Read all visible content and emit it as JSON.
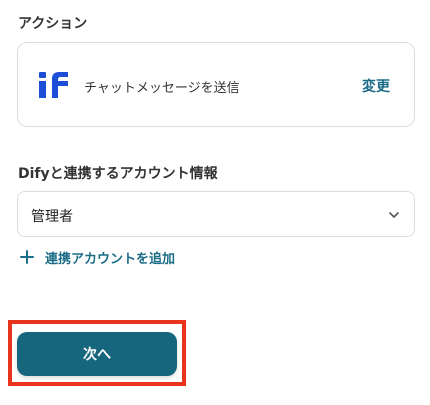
{
  "action_section": {
    "label": "アクション",
    "action_name": "チャットメッセージを送信",
    "change_label": "変更",
    "logo_text": "if"
  },
  "account_section": {
    "label": "Difyと連携するアカウント情報",
    "selected_value": "管理者",
    "add_account_label": "連携アカウントを追加"
  },
  "footer": {
    "next_label": "次へ"
  },
  "colors": {
    "accent": "#1b6c87",
    "button": "#16667e",
    "logo": "#1d4ed8",
    "highlight": "#e8341c"
  }
}
